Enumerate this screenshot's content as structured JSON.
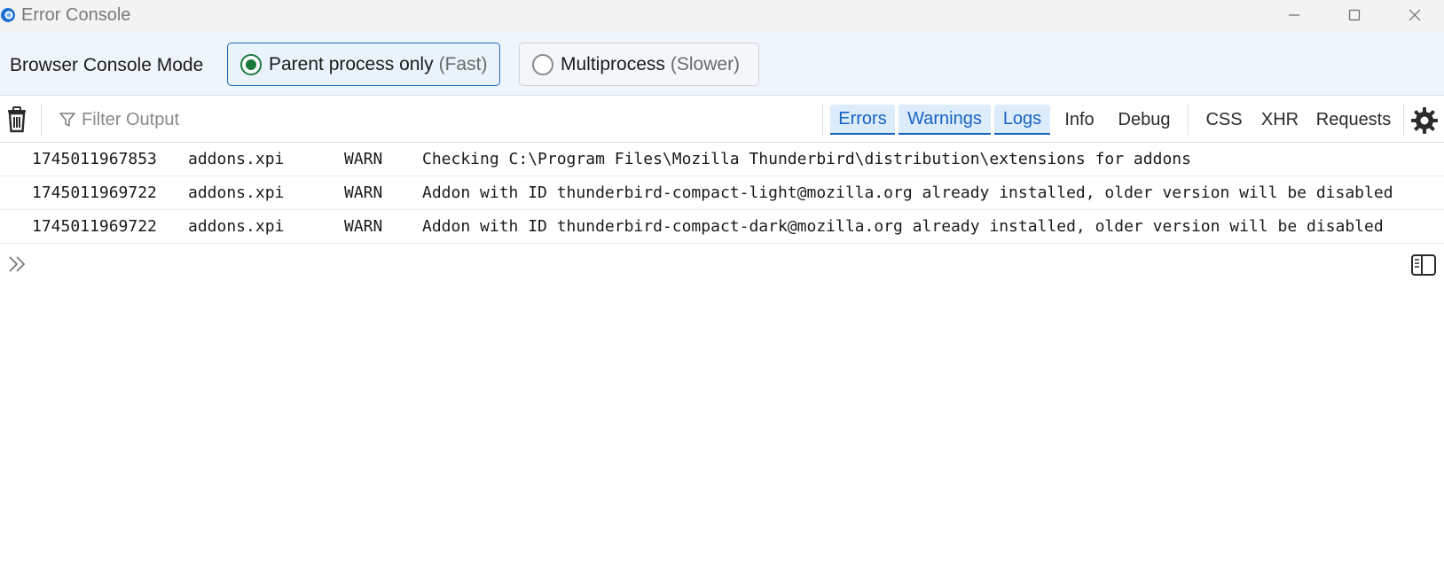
{
  "window": {
    "title": "Error Console",
    "icons": {
      "app": "thunderbird-app-icon",
      "minimize": "minimize-icon",
      "maximize": "maximize-icon",
      "close": "close-icon"
    }
  },
  "mode": {
    "label": "Browser Console Mode",
    "options": [
      {
        "label": "Parent process only",
        "hint": "(Fast)",
        "selected": true
      },
      {
        "label": "Multiprocess",
        "hint": "(Slower)",
        "selected": false
      }
    ]
  },
  "toolbar": {
    "filter_placeholder": "Filter Output",
    "filter_value": "",
    "tabs": [
      {
        "label": "Errors",
        "active": true
      },
      {
        "label": "Warnings",
        "active": true
      },
      {
        "label": "Logs",
        "active": true
      },
      {
        "label": "Info",
        "active": false
      },
      {
        "label": "Debug",
        "active": false
      },
      {
        "label": "CSS",
        "active": false
      },
      {
        "label": "XHR",
        "active": false
      },
      {
        "label": "Requests",
        "active": false
      }
    ],
    "icons": {
      "clear": "trash-icon",
      "filter": "filter-icon",
      "settings": "gear-icon"
    }
  },
  "logs": [
    {
      "timestamp": "1745011967853",
      "source": "addons.xpi",
      "level": "WARN",
      "message": "Checking C:\\Program Files\\Mozilla Thunderbird\\distribution\\extensions for addons"
    },
    {
      "timestamp": "1745011969722",
      "source": "addons.xpi",
      "level": "WARN",
      "message": "Addon with ID thunderbird-compact-light@mozilla.org already installed, older version will be disabled"
    },
    {
      "timestamp": "1745011969722",
      "source": "addons.xpi",
      "level": "WARN",
      "message": "Addon with ID thunderbird-compact-dark@mozilla.org already installed, older version will be disabled"
    }
  ],
  "input": {
    "icons": {
      "prompt": "chevron-double-right-icon",
      "sidebar": "sidebar-toggle-icon"
    }
  },
  "colors": {
    "accent": "#1763c4",
    "radio_selected": "#1a7a3c",
    "mode_bar_bg": "#eef5fb"
  }
}
